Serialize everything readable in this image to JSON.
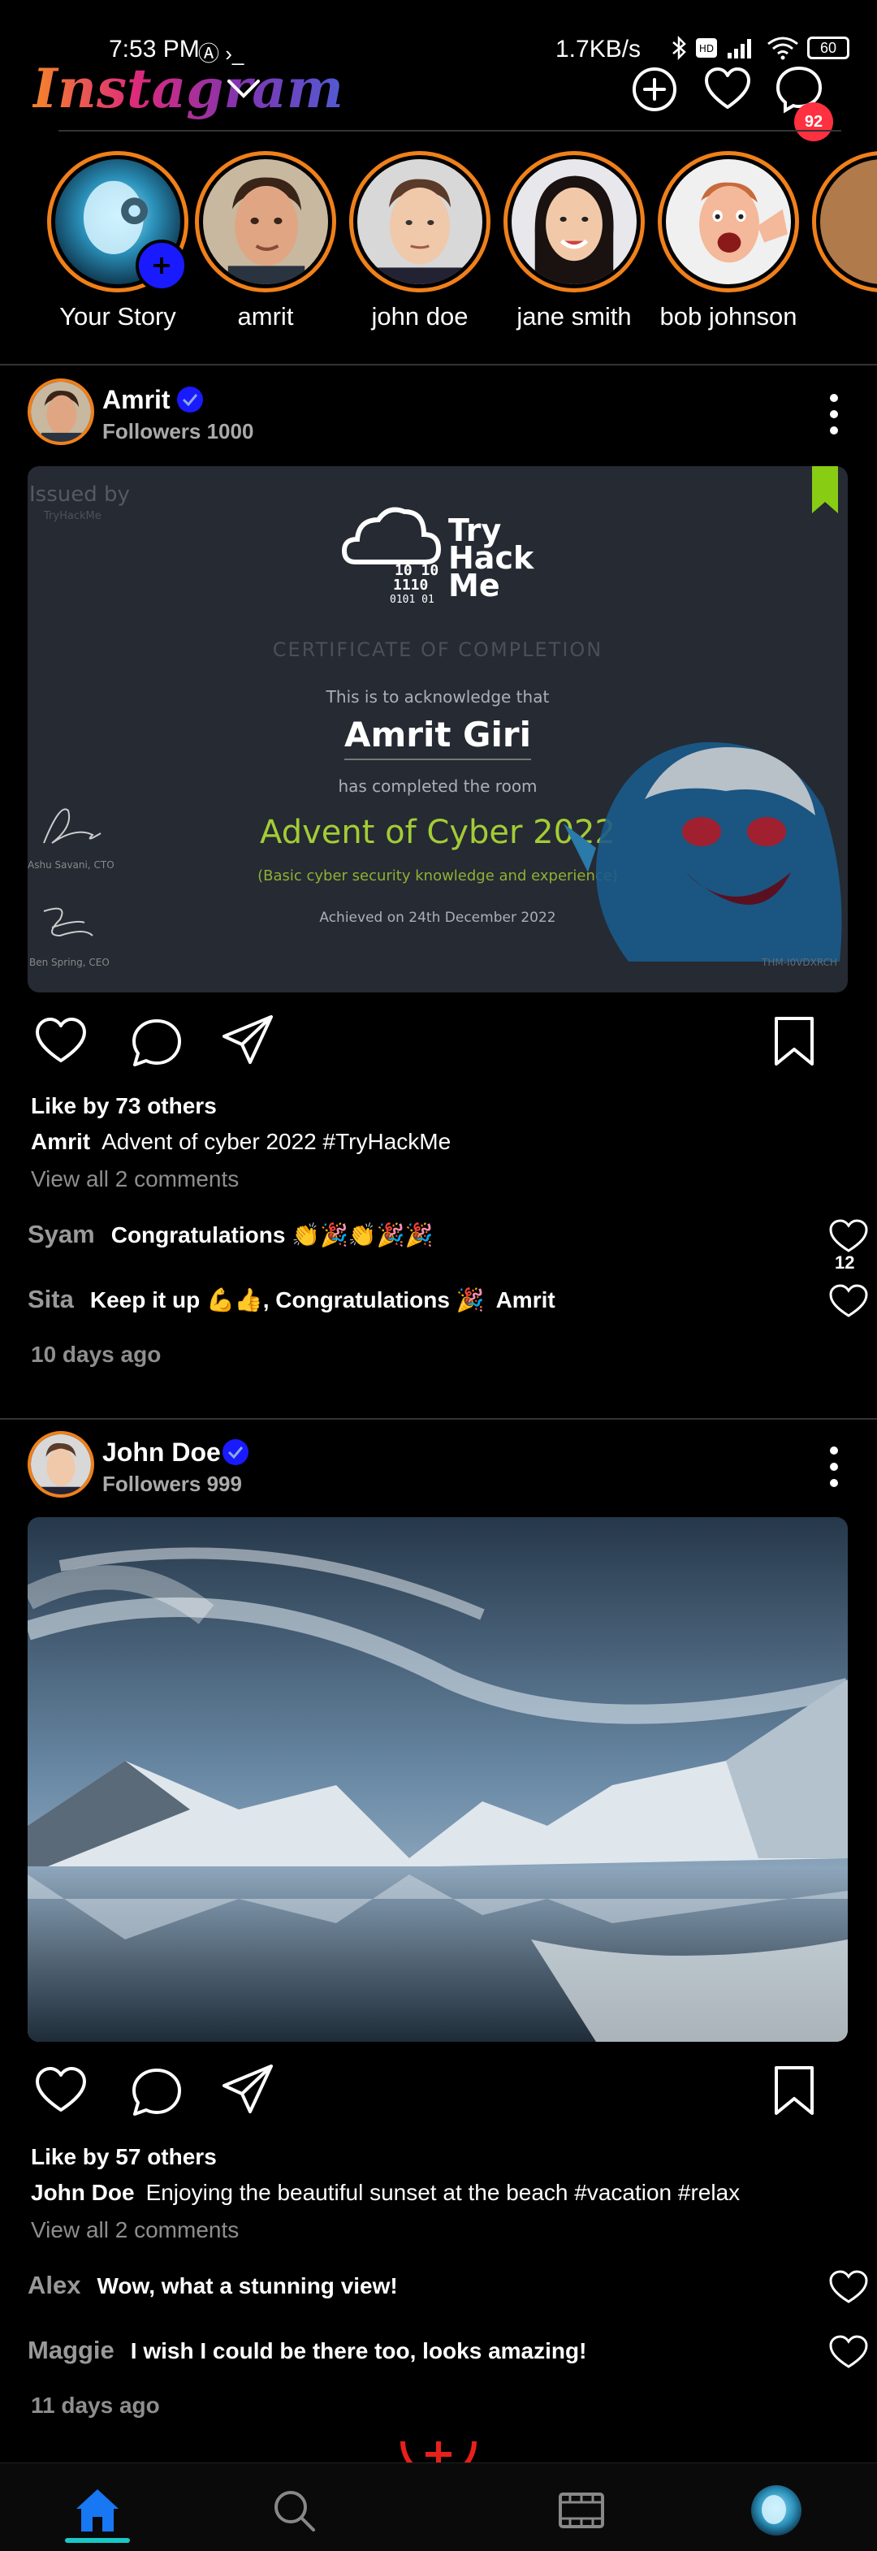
{
  "status_bar": {
    "time": "7:53 PM",
    "left_icons": "Ⓐ ›_",
    "speed": "1.7KB/s",
    "battery": "60"
  },
  "header": {
    "logo": "Instagram",
    "messages_badge": "92"
  },
  "stories": [
    {
      "label": "Your Story"
    },
    {
      "label": "amrit"
    },
    {
      "label": "john doe"
    },
    {
      "label": "jane smith"
    },
    {
      "label": "bob johnson"
    }
  ],
  "posts": [
    {
      "user": "Amrit",
      "followers": "Followers 1000",
      "certificate": {
        "issued_by": "Issued by",
        "issued_by_sub": "TryHackMe",
        "logo_line1": "Try",
        "logo_line2": "Hack",
        "logo_line3": "Me",
        "title": "CERTIFICATE OF COMPLETION",
        "acknowledge": "This is to acknowledge that",
        "name": "Amrit Giri",
        "completed": "has completed the room",
        "room": "Advent of Cyber 2022",
        "room_sub": "(Basic cyber security knowledge and experience)",
        "date": "Achieved on 24th December 2022",
        "sig1": "Ashu Savani, CTO",
        "sig2": "Ben Spring, CEO",
        "cert_id": "THM-I0VDXRCH"
      },
      "like_prefix": "Like by",
      "likes": "73 others",
      "caption_user": "Amrit",
      "caption_text": "Advent of cyber 2022 #TryHackMe",
      "view_comments": "View all 2 comments",
      "comments": [
        {
          "user": "Syam",
          "text": "Congratulations 👏🎉👏🎉🎉",
          "mention": "",
          "like_count": "12"
        },
        {
          "user": "Sita",
          "text": "Keep it up 💪👍, Congratulations 🎉",
          "mention": "Amrit",
          "like_count": ""
        }
      ],
      "time_ago": "10 days ago"
    },
    {
      "user": "John Doe",
      "followers": "Followers 999",
      "like_prefix": "Like by",
      "likes": "57 others",
      "caption_user": "John Doe",
      "caption_text": "Enjoying the beautiful sunset at the beach #vacation #relax",
      "view_comments": "View all 2 comments",
      "comments": [
        {
          "user": "Alex",
          "text": "Wow, what a stunning view!",
          "mention": ""
        },
        {
          "user": "Maggie",
          "text": "I wish I could be there too, looks amazing!",
          "mention": ""
        }
      ],
      "time_ago": "11 days ago"
    }
  ],
  "colors": {
    "accent_ring": "#f0801a",
    "badge": "#ff3040",
    "verified": "#1a1aff",
    "nav_active": "#1877f2",
    "cert_green": "#a3cc34"
  }
}
